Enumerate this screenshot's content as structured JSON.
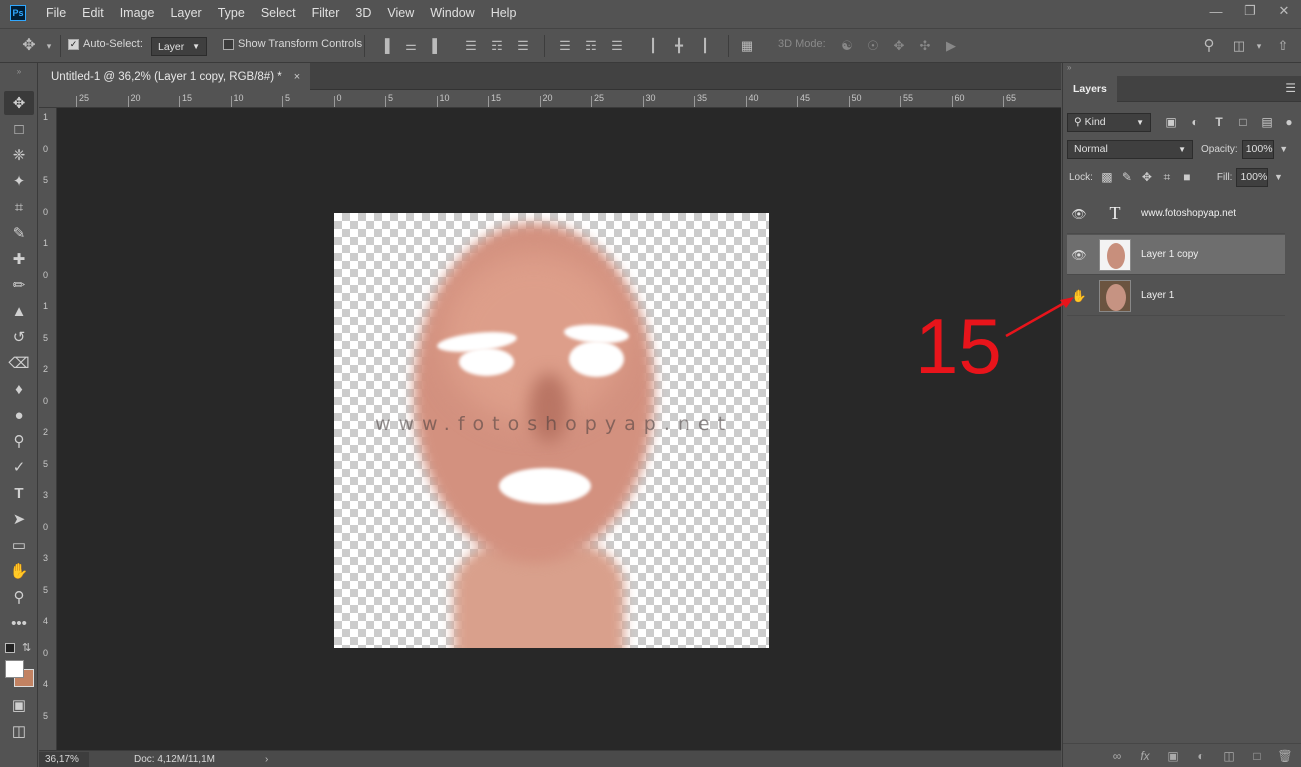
{
  "app": {
    "logo": "Ps"
  },
  "menu": [
    "File",
    "Edit",
    "Image",
    "Layer",
    "Type",
    "Select",
    "Filter",
    "3D",
    "View",
    "Window",
    "Help"
  ],
  "options": {
    "auto_select_label": "Auto-Select:",
    "auto_select_value": "Layer",
    "show_transform_label": "Show Transform Controls",
    "mode_label": "3D Mode:"
  },
  "document": {
    "tab_title": "Untitled-1 @ 36,2% (Layer 1 copy, RGB/8#) *",
    "close": "×",
    "watermark": "www.fotoshopyap.net"
  },
  "ruler": {
    "top": [
      "25",
      "20",
      "15",
      "10",
      "5",
      "0",
      "5",
      "10",
      "15",
      "20",
      "25",
      "30",
      "35",
      "40",
      "45",
      "50",
      "55",
      "60",
      "65"
    ],
    "left": [
      "1",
      "0",
      "5",
      "0",
      "1",
      "0",
      "1",
      "5",
      "2",
      "0",
      "2",
      "5",
      "3",
      "0",
      "3",
      "5",
      "4",
      "0",
      "4",
      "5"
    ]
  },
  "status": {
    "zoom": "36,17%",
    "doc": "Doc: 4,12M/11,1M"
  },
  "layers_panel": {
    "title": "Layers",
    "filter_kind": "Kind",
    "blend_mode": "Normal",
    "opacity_label": "Opacity:",
    "opacity_value": "100%",
    "lock_label": "Lock:",
    "fill_label": "Fill:",
    "fill_value": "100%",
    "layers": [
      {
        "name": "www.fotoshopyap.net",
        "type": "text",
        "visible": true,
        "selected": false
      },
      {
        "name": "Layer 1 copy",
        "type": "pixel",
        "visible": true,
        "selected": true
      },
      {
        "name": "Layer 1",
        "type": "pixel",
        "visible": false,
        "selected": false
      }
    ]
  },
  "annotation": {
    "number": "15",
    "color": "#e8141b"
  }
}
